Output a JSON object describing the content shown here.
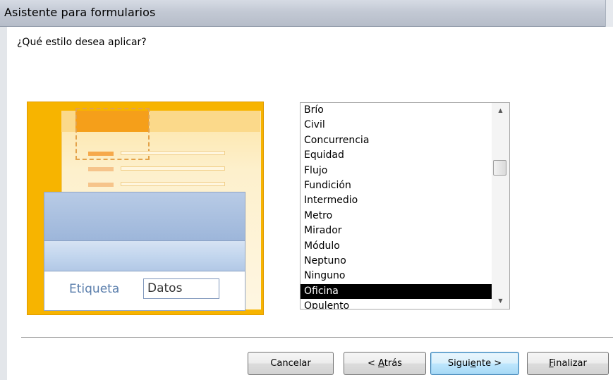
{
  "window": {
    "title": "Asistente para formularios"
  },
  "question": "¿Qué estilo desea aplicar?",
  "preview": {
    "label_text": "Etiqueta",
    "field_text": "Datos"
  },
  "style_list": {
    "items": [
      "Brío",
      "Civil",
      "Concurrencia",
      "Equidad",
      "Flujo",
      "Fundición",
      "Intermedio",
      "Metro",
      "Mirador",
      "Módulo",
      "Neptuno",
      "Ninguno",
      "Oficina",
      "Opulento"
    ],
    "selected": "Oficina"
  },
  "buttons": {
    "cancel": "Cancelar",
    "back_prefix": "< ",
    "back_accel": "A",
    "back_rest": "trás",
    "next_prefix": "Sigui",
    "next_accel": "e",
    "next_rest": "nte >",
    "finish_accel": "F",
    "finish_rest": "inalizar"
  },
  "scrollbar": {
    "up_icon": "arrow-up-icon",
    "down_icon": "arrow-down-icon"
  },
  "colors": {
    "preview_background": "#f7b400",
    "form_header": "#9db6da",
    "selection": "#000000"
  }
}
